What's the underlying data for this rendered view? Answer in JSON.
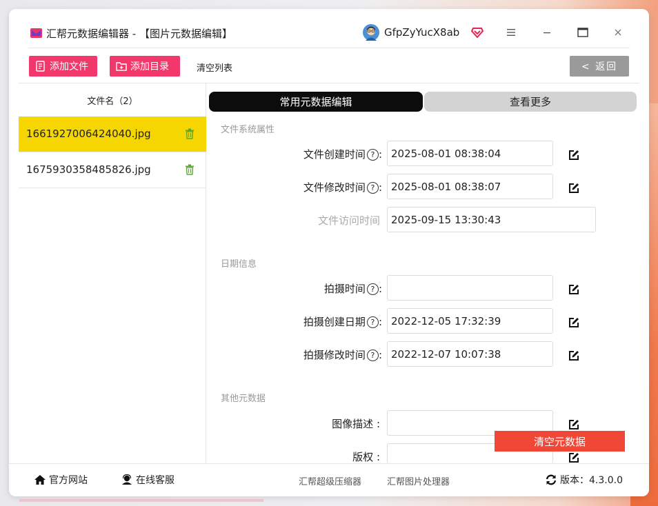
{
  "app": {
    "title": "汇帮元数据编辑器 - 【图片元数据编辑】",
    "user_name": "GfpZyYucX8ab",
    "colors": {
      "accent": "#f2386b",
      "selected_row": "#f5d600",
      "clear_meta": "#f04736",
      "back_button": "#9a9a9a"
    }
  },
  "toolbar": {
    "add_file": "添加文件",
    "add_folder": "添加目录",
    "clear_list": "清空列表",
    "back": "< 返回"
  },
  "file_list": {
    "header": "文件名（2）",
    "files": [
      {
        "name": "1661927006424040.jpg",
        "selected": true
      },
      {
        "name": "1675930358485826.jpg",
        "selected": false
      }
    ]
  },
  "tabs": {
    "common": "常用元数据编辑",
    "more": "查看更多"
  },
  "sections": {
    "fs": "文件系统属性",
    "date": "日期信息",
    "other": "其他元数据"
  },
  "fields": {
    "created": {
      "label": "文件创建时间",
      "value": "2025-08-01 08:38:04"
    },
    "modified": {
      "label": "文件修改时间",
      "value": "2025-08-01 08:38:07"
    },
    "accessed": {
      "label": "文件访问时间",
      "value": "2025-09-15 13:30:43"
    },
    "shot_time": {
      "label": "拍摄时间",
      "value": ""
    },
    "shot_created": {
      "label": "拍摄创建日期",
      "value": "2022-12-05 17:32:39"
    },
    "shot_modified": {
      "label": "拍摄修改时间",
      "value": "2022-12-07 10:07:38"
    },
    "description": {
      "label": "图像描述 :",
      "value": ""
    },
    "copyright": {
      "label": "版权 :",
      "value": ""
    }
  },
  "help_glyph": "?",
  "colon": ":",
  "clear_metadata": "清空元数据",
  "footer": {
    "website": "官方网站",
    "support": "在线客服",
    "link1": "汇帮超级压缩器",
    "link2": "汇帮图片处理器",
    "version": "版本：4.3.0.0"
  }
}
